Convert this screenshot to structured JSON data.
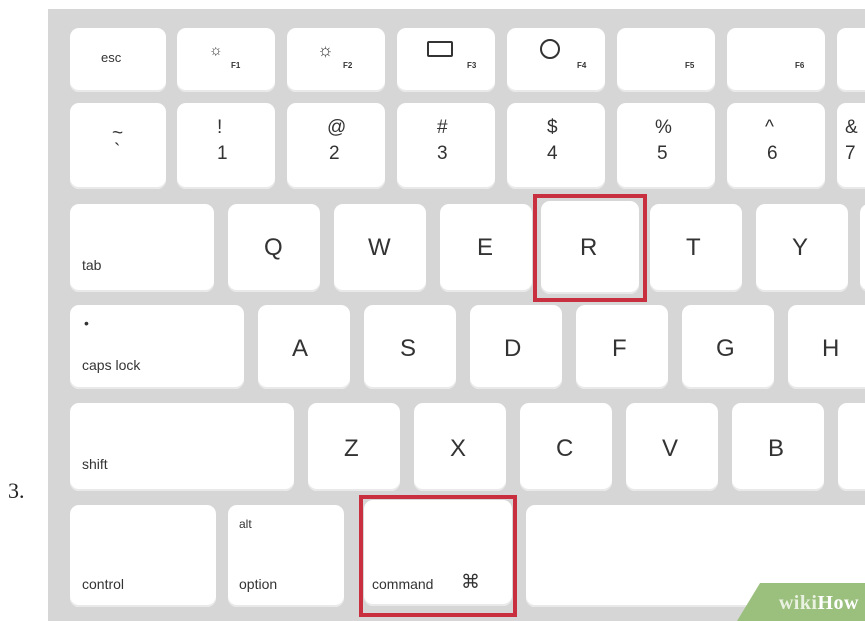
{
  "step_label": "3.",
  "keys": {
    "esc": "esc",
    "f1": "F1",
    "f2": "F2",
    "f3": "F3",
    "f4": "F4",
    "f5": "F5",
    "f6": "F6",
    "tilde_top": "~",
    "tilde_bottom": "`",
    "k1_top": "!",
    "k1_bottom": "1",
    "k2_top": "@",
    "k2_bottom": "2",
    "k3_top": "#",
    "k3_bottom": "3",
    "k4_top": "$",
    "k4_bottom": "4",
    "k5_top": "%",
    "k5_bottom": "5",
    "k6_top": "^",
    "k6_bottom": "6",
    "k7_top": "&",
    "k7_bottom": "7",
    "tab": "tab",
    "q": "Q",
    "w": "W",
    "e": "E",
    "r": "R",
    "t": "T",
    "y": "Y",
    "caps_dot": "•",
    "caps_lock": "caps lock",
    "a": "A",
    "s": "S",
    "d": "D",
    "f": "F",
    "g": "G",
    "h": "H",
    "shift": "shift",
    "z": "Z",
    "x": "X",
    "c": "C",
    "v": "V",
    "b": "B",
    "control": "control",
    "alt": "alt",
    "option": "option",
    "command": "command",
    "command_symbol": "⌘"
  },
  "highlight_color": "#c8303f",
  "watermark": {
    "wiki": "wiki",
    "how": "How"
  }
}
